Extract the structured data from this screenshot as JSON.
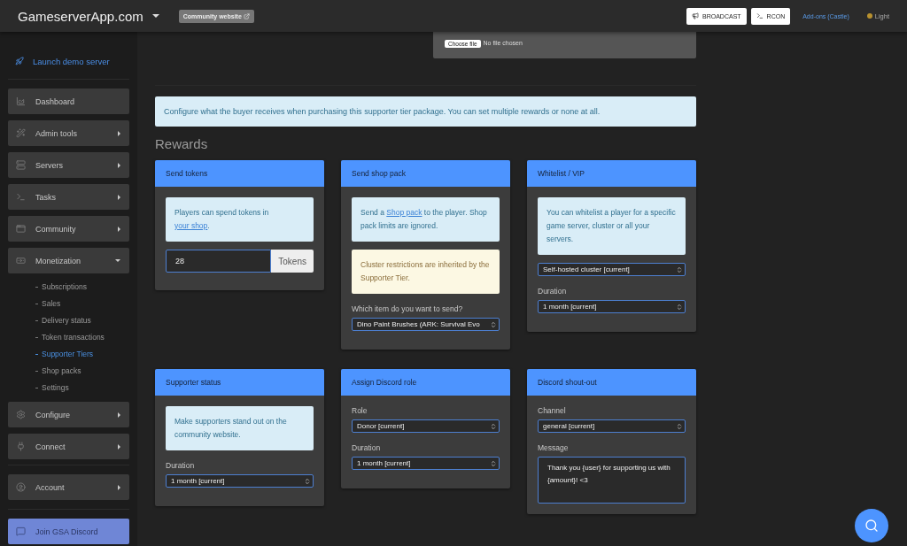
{
  "topbar": {
    "brand": "GameserverApp.com",
    "community_button": "Community website",
    "buttons": [
      {
        "kind": "broadcast",
        "label": "BROADCAST"
      },
      {
        "kind": "rcon",
        "label": "RCON"
      }
    ],
    "addons_link": "Add-ons (Castle)",
    "theme_toggle": "Light"
  },
  "sidebar": {
    "demo_link": "Launch demo server",
    "items": [
      {
        "kind": "dashboard",
        "label": "Dashboard"
      },
      {
        "kind": "admin",
        "label": "Admin tools",
        "expanded": false
      },
      {
        "kind": "servers",
        "label": "Servers",
        "expanded": false
      },
      {
        "kind": "tasks",
        "label": "Tasks",
        "expanded": false
      },
      {
        "kind": "community",
        "label": "Community",
        "expanded": false
      },
      {
        "kind": "monetization",
        "label": "Monetization",
        "expanded": true,
        "children": [
          {
            "label": "Subscriptions",
            "selected": false
          },
          {
            "label": "Sales",
            "selected": false
          },
          {
            "label": "Delivery status",
            "selected": false
          },
          {
            "label": "Token transactions",
            "selected": false
          },
          {
            "label": "Supporter Tiers",
            "selected": true
          },
          {
            "label": "Shop packs",
            "selected": false
          },
          {
            "label": "Settings",
            "selected": false
          }
        ]
      },
      {
        "kind": "configure",
        "label": "Configure",
        "expanded": false
      },
      {
        "kind": "connect",
        "label": "Connect",
        "expanded": false
      },
      {
        "kind": "account",
        "label": "Account",
        "expanded": false
      }
    ],
    "discord_button": "Join GSA Discord"
  },
  "file_upload": {
    "button": "Choose file",
    "status": "No file chosen"
  },
  "info": "Configure what the buyer receives when purchasing this supporter tier package. You can set multiple rewards or none at all.",
  "section_title": "Rewards",
  "cards": [
    {
      "title": "Send tokens",
      "blocks": [
        {
          "kind": "info",
          "parts": [
            {
              "text": "Players can spend tokens in "
            },
            {
              "text": "your shop",
              "link": true
            },
            {
              "text": "."
            }
          ]
        },
        {
          "kind": "amount",
          "value": "28",
          "addon": "Tokens"
        }
      ]
    },
    {
      "title": "Send shop pack",
      "blocks": [
        {
          "kind": "info",
          "parts": [
            {
              "text": "Send a "
            },
            {
              "text": "Shop pack",
              "link": true
            },
            {
              "text": " to the player. Shop pack limits are ignored."
            }
          ]
        },
        {
          "kind": "warning",
          "text": "Cluster restrictions are inherited by the Supporter Tier."
        },
        {
          "kind": "label",
          "text": "Which item do you want to send?"
        },
        {
          "kind": "select",
          "value": "Dino Paint Brushes (ARK: Survival Evo"
        }
      ]
    },
    {
      "title": "Whitelist / VIP",
      "blocks": [
        {
          "kind": "info",
          "parts": [
            {
              "text": "You can whitelist a player for a specific game server, cluster or all your servers."
            }
          ]
        },
        {
          "kind": "select",
          "value": "Self-hosted cluster [current]"
        },
        {
          "kind": "label",
          "text": "Duration"
        },
        {
          "kind": "select",
          "value": "1 month [current]"
        }
      ]
    },
    {
      "title": "Supporter status",
      "blocks": [
        {
          "kind": "info",
          "parts": [
            {
              "text": "Make supporters stand out on the community website."
            }
          ]
        },
        {
          "kind": "label",
          "text": "Duration"
        },
        {
          "kind": "select",
          "value": "1 month [current]"
        }
      ]
    },
    {
      "title": "Assign Discord role",
      "blocks": [
        {
          "kind": "label",
          "text": "Role"
        },
        {
          "kind": "select",
          "value": "Donor [current]"
        },
        {
          "kind": "label",
          "text": "Duration"
        },
        {
          "kind": "select",
          "value": "1 month [current]"
        }
      ]
    },
    {
      "title": "Discord shout-out",
      "blocks": [
        {
          "kind": "label",
          "text": "Channel"
        },
        {
          "kind": "select",
          "value": "general [current]"
        },
        {
          "kind": "label",
          "text": "Message"
        },
        {
          "kind": "textarea",
          "value": "Thank you {user} for supporting us with {amount}! <3"
        }
      ]
    }
  ]
}
